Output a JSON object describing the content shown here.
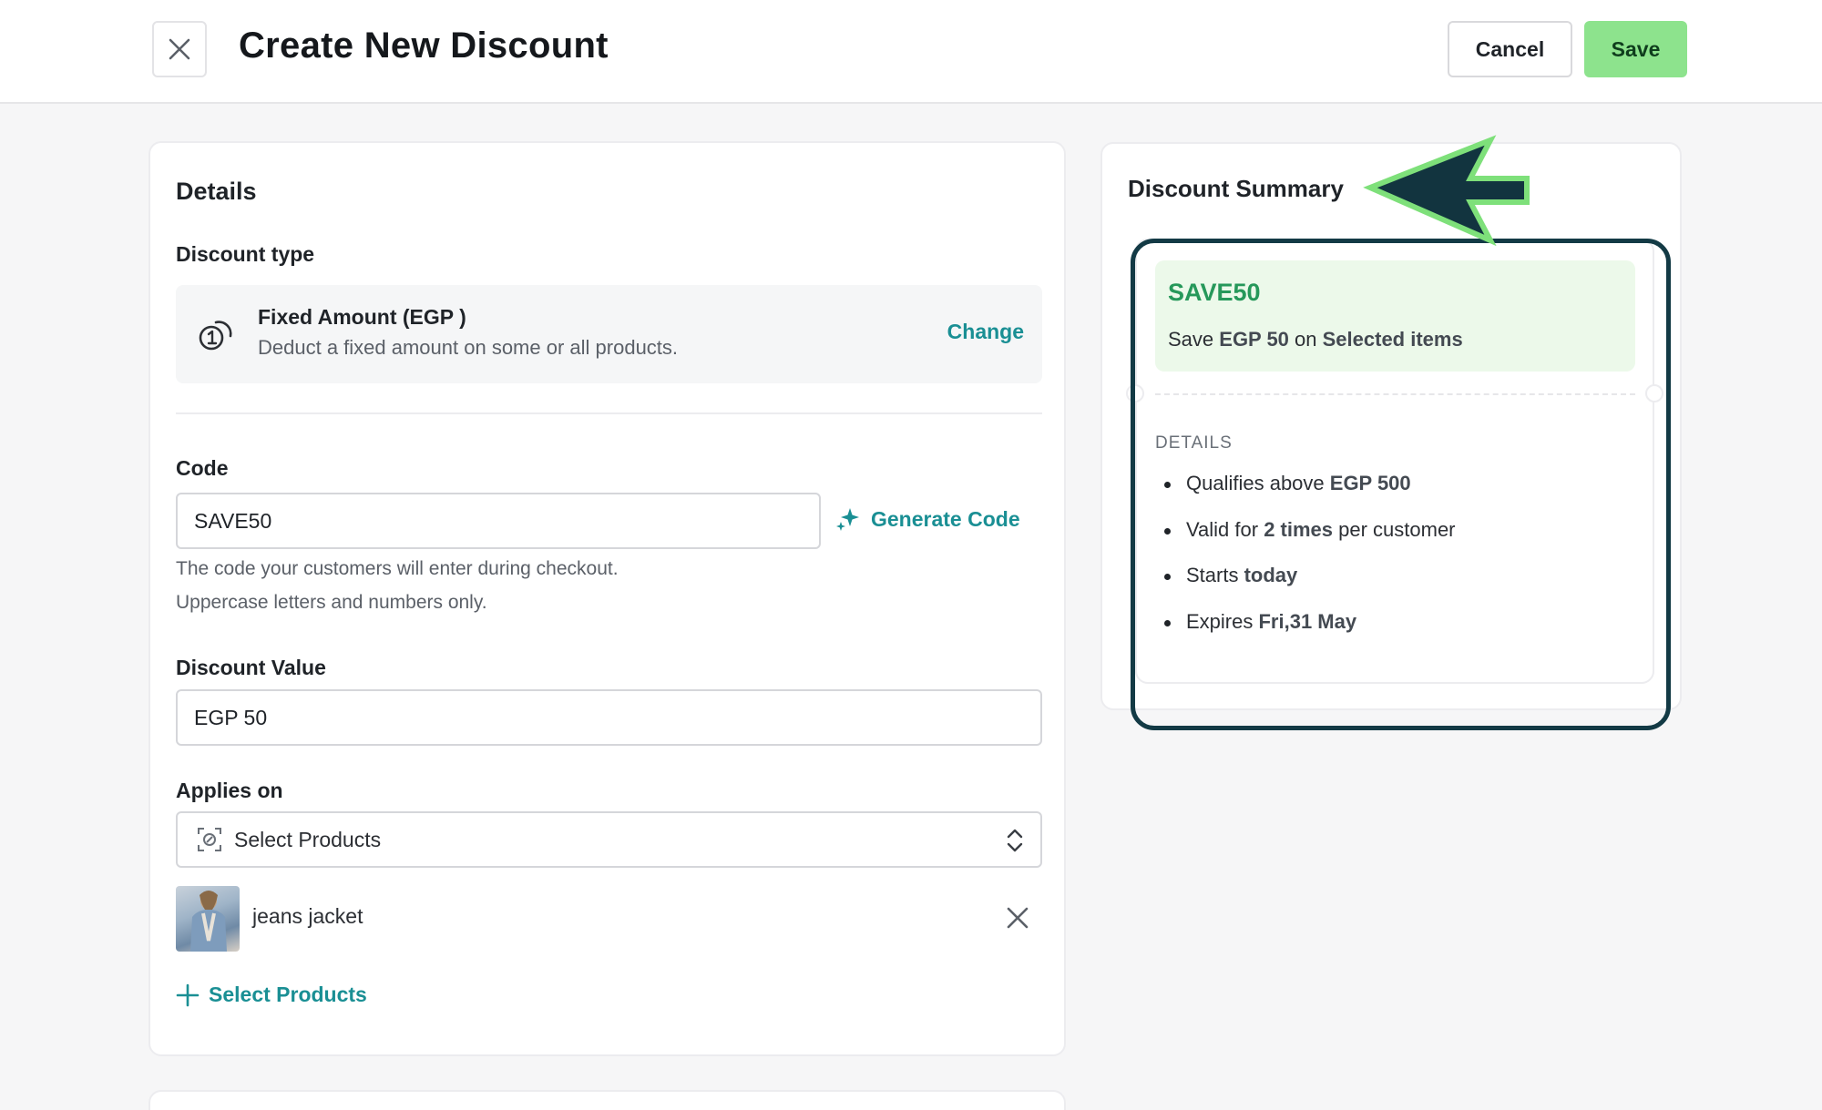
{
  "header": {
    "title": "Create New Discount",
    "cancel_label": "Cancel",
    "save_label": "Save"
  },
  "details": {
    "section_title": "Details",
    "discount_type_label": "Discount type",
    "discount_type": {
      "title": "Fixed Amount (EGP )",
      "description": "Deduct a fixed amount on some or all products.",
      "change_label": "Change"
    },
    "code": {
      "label": "Code",
      "value": "SAVE50",
      "generate_label": "Generate Code",
      "help_1": "The code your customers will enter during checkout.",
      "help_2": "Uppercase letters and numbers only."
    },
    "discount_value": {
      "label": "Discount Value",
      "value": "EGP 50"
    },
    "applies_on": {
      "label": "Applies on",
      "selected": "Select Products",
      "products": [
        {
          "name": "jeans jacket"
        }
      ],
      "add_label": "Select Products"
    }
  },
  "summary": {
    "title": "Discount Summary",
    "code": "SAVE50",
    "line": {
      "prefix": "Save ",
      "amount": "EGP 50",
      "middle": " on ",
      "target": "Selected items"
    },
    "details_heading": "DETAILS",
    "items": [
      {
        "prefix": "Qualifies above ",
        "value": "EGP 500",
        "suffix": ""
      },
      {
        "prefix": "Valid for ",
        "value": "2 times",
        "suffix": " per customer"
      },
      {
        "prefix": "Starts ",
        "value": "today",
        "suffix": ""
      },
      {
        "prefix": "Expires ",
        "value": "Fri,31 May",
        "suffix": ""
      }
    ]
  },
  "colors": {
    "accent_teal": "#1a8f94",
    "save_green": "#8de38d",
    "coupon_green": "#26985a",
    "annotation_dark": "#133a45",
    "annotation_green": "#7ee07a"
  },
  "icons": {
    "close": "close-icon",
    "coin": "coin-icon",
    "sparkle": "sparkle-icon",
    "product_select": "product-select-icon",
    "arrows": "chevron-up-down-icon",
    "remove": "remove-icon",
    "plus": "plus-icon"
  }
}
